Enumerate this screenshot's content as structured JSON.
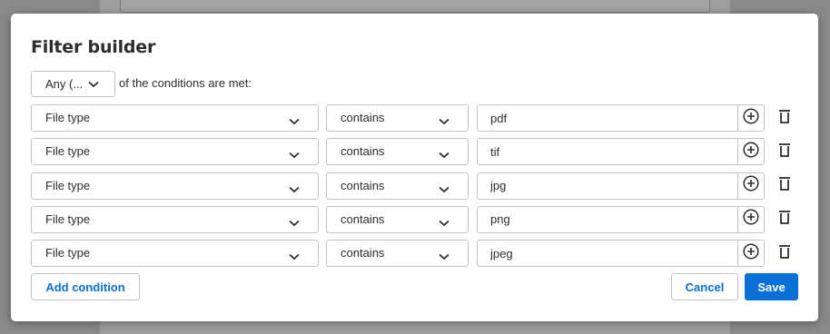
{
  "backdrop": {
    "input_text": "— — — — — — — —"
  },
  "dialog": {
    "title": "Filter builder",
    "match_select": "Any (...",
    "match_text": "of the conditions are met:",
    "conditions": [
      {
        "field": "File type",
        "operator": "contains",
        "value": "pdf"
      },
      {
        "field": "File type",
        "operator": "contains",
        "value": "tif"
      },
      {
        "field": "File type",
        "operator": "contains",
        "value": "jpg"
      },
      {
        "field": "File type",
        "operator": "contains",
        "value": "png"
      },
      {
        "field": "File type",
        "operator": "contains",
        "value": "jpeg"
      }
    ],
    "add_condition_label": "Add condition",
    "cancel_label": "Cancel",
    "save_label": "Save"
  },
  "icons": {
    "chevron": "chevron-down-icon",
    "add": "plus-circle-icon",
    "delete": "trash-icon"
  },
  "colors": {
    "accent": "#0a6fd6",
    "border": "#c4c4c4",
    "overlay": "#8a8a8a"
  }
}
